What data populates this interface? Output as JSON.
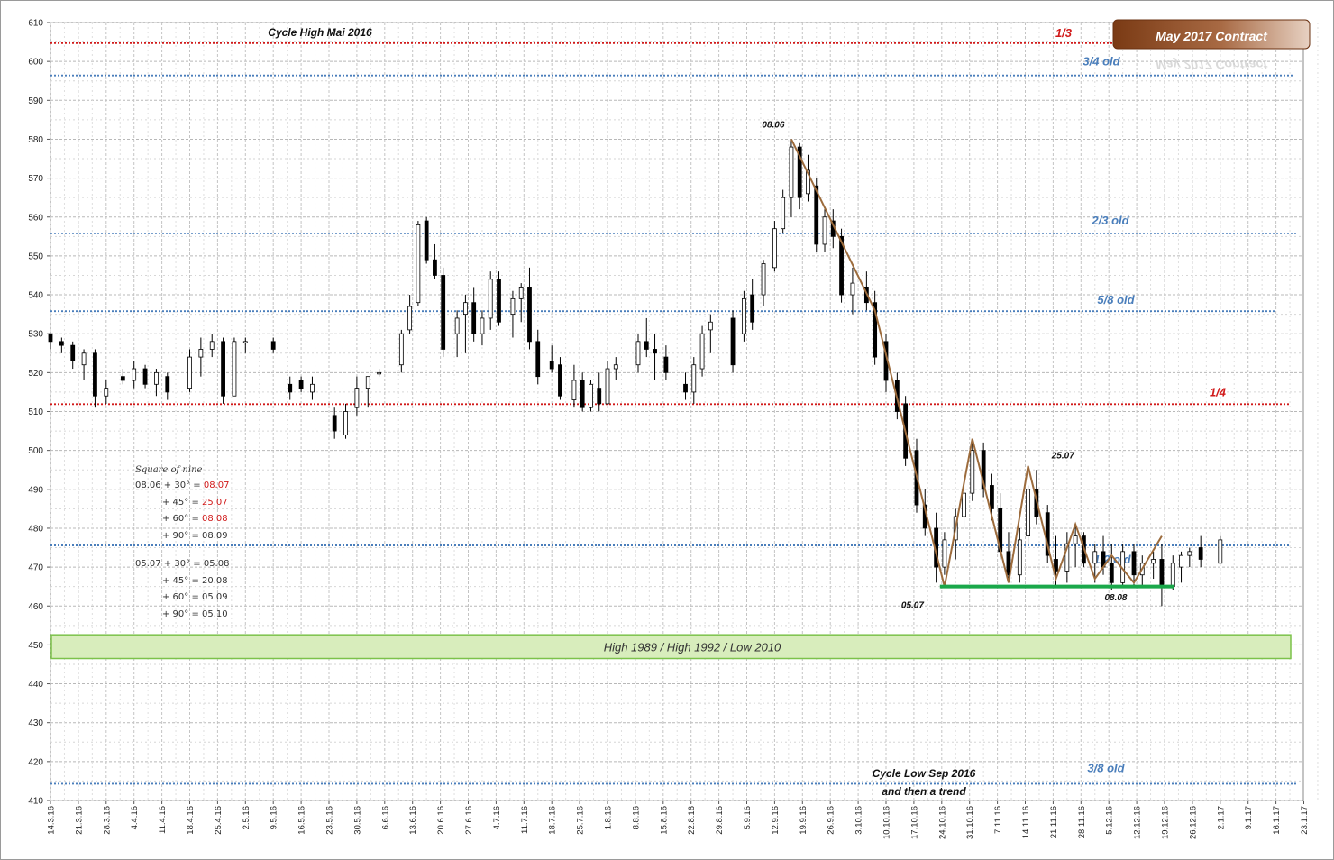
{
  "chart_data": {
    "type": "candlestick",
    "title": "May 2017 Contract",
    "y_range": [
      410,
      610
    ],
    "y_ticks": [
      410,
      420,
      430,
      440,
      450,
      460,
      470,
      480,
      490,
      500,
      510,
      520,
      530,
      540,
      550,
      560,
      570,
      580,
      590,
      600,
      610
    ],
    "x_ticks": [
      "14.3.16",
      "21.3.16",
      "28.3.16",
      "4.4.16",
      "11.4.16",
      "18.4.16",
      "25.4.16",
      "2.5.16",
      "9.5.16",
      "16.5.16",
      "23.5.16",
      "30.5.16",
      "6.6.16",
      "13.6.16",
      "20.6.16",
      "27.6.16",
      "4.7.16",
      "11.7.16",
      "18.7.16",
      "25.7.16",
      "1.8.16",
      "8.8.16",
      "15.8.16",
      "22.8.16",
      "29.8.16",
      "5.9.16",
      "12.9.16",
      "19.9.16",
      "26.9.16",
      "3.10.16",
      "10.10.16",
      "17.10.16",
      "24.10.16",
      "31.10.16",
      "7.11.16",
      "14.11.16",
      "21.11.16",
      "28.11.16",
      "5.12.16",
      "12.12.16",
      "19.12.16",
      "26.12.16",
      "2.1.17",
      "9.1.17",
      "16.1.17",
      "23.1.17"
    ],
    "grid": true,
    "candles": [
      [
        0,
        530,
        530,
        526,
        528
      ],
      [
        0.4,
        528,
        529,
        525,
        527
      ],
      [
        0.8,
        527,
        528,
        521,
        523
      ],
      [
        1.2,
        522,
        526,
        518,
        525
      ],
      [
        1.6,
        525,
        526,
        511,
        514
      ],
      [
        2.0,
        514,
        518,
        512,
        516
      ],
      [
        2.6,
        519,
        521,
        517,
        518
      ],
      [
        3.0,
        518,
        523,
        516,
        521
      ],
      [
        3.4,
        521,
        522,
        516,
        517
      ],
      [
        3.8,
        517,
        521,
        514,
        520
      ],
      [
        4.2,
        519,
        520,
        513,
        515
      ],
      [
        5.0,
        516,
        526,
        515,
        524
      ],
      [
        5.4,
        524,
        529,
        519,
        526
      ],
      [
        5.8,
        526,
        530,
        524,
        528
      ],
      [
        6.2,
        528,
        529,
        512,
        514
      ],
      [
        6.6,
        514,
        529,
        514,
        528
      ],
      [
        7.0,
        528,
        529,
        525,
        528
      ],
      [
        8.0,
        528,
        529,
        525,
        526
      ],
      [
        8.6,
        517,
        519,
        513,
        515
      ],
      [
        9.0,
        518,
        519,
        515,
        516
      ],
      [
        9.4,
        515,
        519,
        513,
        517
      ],
      [
        10.2,
        509,
        511,
        503,
        505
      ],
      [
        10.6,
        504,
        512,
        503,
        510
      ],
      [
        11.0,
        511,
        519,
        509,
        516
      ],
      [
        11.4,
        516,
        519,
        511,
        519
      ],
      [
        11.8,
        520,
        521,
        519,
        520
      ],
      [
        12.6,
        522,
        531,
        520,
        530
      ],
      [
        12.9,
        531,
        540,
        530,
        537
      ],
      [
        13.2,
        538,
        559,
        537,
        558
      ],
      [
        13.5,
        559,
        560,
        548,
        549
      ],
      [
        13.8,
        549,
        553,
        544,
        545
      ],
      [
        14.1,
        545,
        547,
        524,
        526
      ],
      [
        14.6,
        530,
        536,
        524,
        534
      ],
      [
        14.9,
        535,
        540,
        525,
        538
      ],
      [
        15.2,
        538,
        542,
        528,
        530
      ],
      [
        15.5,
        530,
        536,
        527,
        534
      ],
      [
        15.8,
        534,
        546,
        531,
        544
      ],
      [
        16.1,
        544,
        546,
        532,
        533
      ],
      [
        16.6,
        535,
        541,
        529,
        539
      ],
      [
        16.9,
        539,
        543,
        533,
        542
      ],
      [
        17.2,
        542,
        547,
        526,
        528
      ],
      [
        17.5,
        528,
        531,
        517,
        519
      ],
      [
        18.0,
        523,
        527,
        520,
        521
      ],
      [
        18.3,
        522,
        524,
        513,
        514
      ],
      [
        18.8,
        513,
        522,
        511,
        518
      ],
      [
        19.1,
        518,
        520,
        510,
        511
      ],
      [
        19.4,
        511,
        518,
        510,
        517
      ],
      [
        19.7,
        516,
        520,
        510,
        512
      ],
      [
        20.0,
        512,
        523,
        512,
        521
      ],
      [
        20.3,
        521,
        524,
        518,
        522
      ],
      [
        21.1,
        522,
        530,
        520,
        528
      ],
      [
        21.4,
        528,
        534,
        524,
        526
      ],
      [
        21.7,
        526,
        530,
        518,
        525
      ],
      [
        22.1,
        524,
        527,
        518,
        520
      ],
      [
        22.8,
        517,
        520,
        513,
        515
      ],
      [
        23.1,
        515,
        524,
        512,
        522
      ],
      [
        23.4,
        521,
        532,
        519,
        530
      ],
      [
        23.7,
        531,
        535,
        525,
        533
      ],
      [
        24.5,
        534,
        536,
        520,
        522
      ],
      [
        24.9,
        530,
        541,
        528,
        539
      ],
      [
        25.2,
        540,
        544,
        531,
        533
      ],
      [
        25.6,
        540,
        549,
        537,
        548
      ],
      [
        26.0,
        547,
        559,
        546,
        557
      ],
      [
        26.3,
        557,
        567,
        556,
        565
      ],
      [
        26.6,
        565,
        580,
        560,
        578
      ],
      [
        26.9,
        578,
        579,
        562,
        565
      ],
      [
        27.2,
        566,
        576,
        564,
        572
      ],
      [
        27.5,
        568,
        570,
        551,
        553
      ],
      [
        27.8,
        553,
        562,
        551,
        560
      ],
      [
        28.1,
        559,
        562,
        552,
        555
      ],
      [
        28.4,
        555,
        557,
        538,
        540
      ],
      [
        28.8,
        540,
        547,
        535,
        543
      ],
      [
        29.3,
        542,
        546,
        536,
        538
      ],
      [
        29.6,
        538,
        541,
        522,
        524
      ],
      [
        30.0,
        528,
        530,
        515,
        518
      ],
      [
        30.4,
        518,
        520,
        508,
        510
      ],
      [
        30.7,
        512,
        514,
        496,
        498
      ],
      [
        31.1,
        500,
        503,
        484,
        486
      ],
      [
        31.4,
        486,
        490,
        478,
        480
      ],
      [
        31.8,
        480,
        484,
        466,
        470
      ],
      [
        32.1,
        470,
        479,
        468,
        477
      ],
      [
        32.5,
        477,
        485,
        472,
        483
      ],
      [
        32.8,
        483,
        491,
        480,
        489
      ],
      [
        33.1,
        489,
        503,
        487,
        500
      ],
      [
        33.5,
        500,
        502,
        488,
        490
      ],
      [
        33.8,
        491,
        494,
        482,
        485
      ],
      [
        34.1,
        485,
        489,
        472,
        474
      ],
      [
        34.4,
        474,
        479,
        466,
        468
      ],
      [
        34.8,
        468,
        480,
        466,
        477
      ],
      [
        35.1,
        478,
        491,
        476,
        490
      ],
      [
        35.4,
        490,
        495,
        481,
        483
      ],
      [
        35.8,
        484,
        486,
        471,
        473
      ],
      [
        36.1,
        472,
        478,
        465,
        469
      ],
      [
        36.5,
        469,
        479,
        466,
        476
      ],
      [
        36.8,
        476,
        481,
        470,
        478
      ],
      [
        37.1,
        478,
        479,
        470,
        471
      ],
      [
        37.5,
        471,
        476,
        466,
        474
      ],
      [
        37.8,
        474,
        478,
        468,
        470
      ],
      [
        38.1,
        471,
        476,
        464,
        466
      ],
      [
        38.5,
        466,
        476,
        465,
        474
      ],
      [
        38.9,
        474,
        476,
        465,
        468
      ],
      [
        39.2,
        468,
        473,
        465,
        471
      ],
      [
        39.6,
        471,
        474,
        467,
        472
      ],
      [
        39.9,
        472,
        476,
        460,
        465
      ],
      [
        40.3,
        465,
        473,
        464,
        471
      ],
      [
        40.6,
        470,
        474,
        466,
        473
      ],
      [
        40.9,
        473,
        475,
        470,
        474
      ],
      [
        41.3,
        475,
        478,
        470,
        472
      ],
      [
        42.0,
        471,
        478,
        471,
        477
      ]
    ],
    "zigzag": [
      [
        26.6,
        580
      ],
      [
        29.6,
        536
      ],
      [
        32.1,
        465
      ],
      [
        33.1,
        503
      ],
      [
        34.4,
        466
      ],
      [
        35.1,
        496
      ],
      [
        36.1,
        467
      ],
      [
        36.8,
        481
      ],
      [
        37.5,
        467
      ],
      [
        38.1,
        473
      ],
      [
        38.9,
        466
      ],
      [
        39.9,
        478
      ]
    ],
    "horizontal_levels": [
      {
        "y": 604.7,
        "label": "1/3",
        "color": "#d11a1a"
      },
      {
        "y": 596.4,
        "label": "3/4 old",
        "color": "#4a7ebb"
      },
      {
        "y": 555.8,
        "label": "2/3 old",
        "color": "#4a7ebb"
      },
      {
        "y": 535.8,
        "label": "5/8 old",
        "color": "#4a7ebb"
      },
      {
        "y": 511.9,
        "label": "1/4",
        "color": "#d11a1a"
      },
      {
        "y": 475.6,
        "label": "1/2 old",
        "color": "#4a7ebb"
      },
      {
        "y": 414.3,
        "label": "3/8 old",
        "color": "#4a7ebb"
      }
    ],
    "support_line": {
      "y": 465.0,
      "x_from": 32.0,
      "x_to": 40.2,
      "color": "#1aa84a"
    },
    "zone": {
      "y_low": 446.5,
      "y_high": 452.6,
      "label": "High 1989 / High 1992 / Low 2010",
      "fill": "#d8edbc",
      "stroke": "#7cc24a"
    },
    "point_labels": [
      {
        "x": 26.0,
        "y": 583,
        "text": "08.06"
      },
      {
        "x": 36.4,
        "y": 498,
        "text": "25.07"
      },
      {
        "x": 31.0,
        "y": 459.5,
        "text": "05.07"
      },
      {
        "x": 38.3,
        "y": 461.5,
        "text": "08.08"
      }
    ],
    "annotations": [
      {
        "text": "Cycle High Mai 2016"
      },
      {
        "text": "Cycle Low Sep 2016"
      },
      {
        "text": "and then a trend"
      }
    ],
    "square_of_nine": {
      "title": "Square of nine",
      "lines": [
        {
          "prefix": "08.06 + 30° = ",
          "value": "08.07",
          "color": "#d11a1a"
        },
        {
          "prefix": "+ 45° = ",
          "value": "25.07",
          "color": "#d11a1a"
        },
        {
          "prefix": "+ 60° = ",
          "value": "08.08",
          "color": "#d11a1a"
        },
        {
          "prefix": "+ 90° = ",
          "value": "08.09",
          "color": "#333333"
        },
        {
          "prefix": "05.07 + 30° = ",
          "value": "05.08",
          "color": "#333333"
        },
        {
          "prefix": "+ 45° = ",
          "value": "20.08",
          "color": "#333333"
        },
        {
          "prefix": "+ 60° = ",
          "value": "05.09",
          "color": "#333333"
        },
        {
          "prefix": "+ 90° = ",
          "value": "05.10",
          "color": "#333333"
        }
      ]
    }
  }
}
